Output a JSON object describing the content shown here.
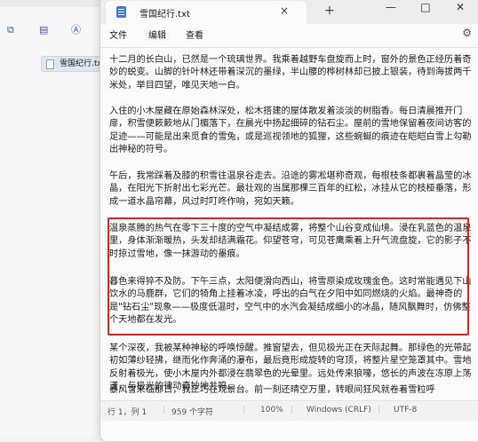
{
  "explorer": {
    "file_name": "雪国纪行.txt"
  },
  "notepad": {
    "tab_title": "雪国纪行.txt",
    "tab_close": "×",
    "new_tab": "+",
    "win_minimize": "—",
    "win_maximize": "□",
    "win_close": "✕",
    "menu": [
      "文件",
      "编辑",
      "查看"
    ],
    "settings_icon": "⚙",
    "paragraphs": [
      "十二月的长白山，已然是一个琉璃世界。我乘着越野车盘旋而上时，窗外的景色正经历着奇妙的蜕变。山脚的针叶林还带着深沉的墨绿，半山腰的桦树林却已披上银装，待到海拔两千米处，举目四望，唯见天地一白。",
      "入住的小木屋藏在原始森林深处，松木搭建的屋体散发着淡淡的树脂香。每日清晨推开门扉，积雪便簌簌地从门楣落下，在晨光中扬起细碎的钻石尘。屋前的雪地保留着夜间访客的足迹——可能是出来觅食的雪兔，或是巡视领地的狐狸，这些蜿蜒的痕迹在皑皑白雪上勾勒出神秘的符号。",
      "午后，我常踩着及膝的积雪往温泉谷走去。沿途的雾凇堪称奇观，每根枝条都裹着晶莹的冰晶，在阳光下折射出七彩光芒。最壮观的当属那棵三百年的红松，冰挂从它的枝桠垂落，形成一道水晶帘幕，风过时叮咚作响，宛如天籁。",
      "温泉蒸腾的热气在零下三十度的空气中凝结成雾，将整个山谷变成仙境。浸在乳蓝色的温泉里，身体渐渐暖热，头发却结满霜花。仰望苍穹，可见苍鹰乘着上升气流盘旋，它的影子不时掠过雪地，像一抹游动的墨痕。",
      "暮色来得猝不及防。下午三点，太阳便滑向西山，将雪原染成玫瑰金色。这时常能遇见下山饮水的马鹿群，它们的犄角上挂着冰凌，呼出的白气在夕阳中如同燃烧的火焰。最神奇的是\"钻石尘\"现象——极度低温时，空气中的水汽会凝结成细小的冰晶，随风飘舞时，仿佛整个天地都在发光。",
      "某个深夜，我被某种神秘的呼唤惊醒。推窗望去，但见极光正在天际起舞。那绿色的光带起初如薄纱轻拂，继而化作奔涌的瀑布，最后竟形成旋转的穹顶，将整片星空笼罩其中。雪地反射着极光，使小木屋内外都浸在翡翠色的光晕里。远处传来狼嚎，悠长的声波在冻原上荡漾，与极光的律动奇妙地共鸣。",
      "暴风雪来临那日，我正巧在观景台。前一刻还晴空万里，转眼间狂风就卷着雪粒呼"
    ],
    "status": {
      "position": "行 1，列 1",
      "chars": "959 个字符",
      "zoom": "100%",
      "line_ending": "Windows (CRLF)",
      "encoding": "UTF-8"
    }
  }
}
